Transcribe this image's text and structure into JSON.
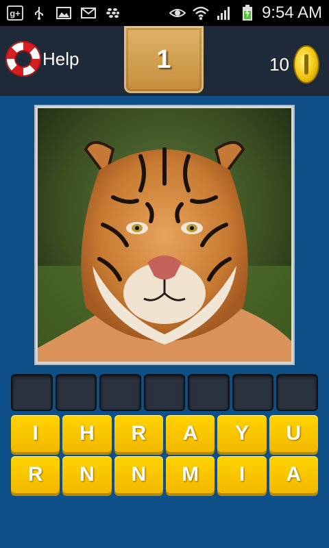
{
  "status_bar": {
    "icons": [
      "google-plus-icon",
      "usb-icon",
      "image-icon",
      "gmail-icon",
      "bbm-icon",
      "eye-icon",
      "wifi-icon",
      "signal-icon",
      "battery-icon"
    ],
    "time": "9:54 AM"
  },
  "header": {
    "help_label": "Help",
    "level": "1",
    "coins": "10"
  },
  "puzzle": {
    "image": "tiger-photo",
    "slots": [
      "",
      "",
      "",
      "",
      "",
      "",
      ""
    ],
    "letters": [
      "I",
      "H",
      "R",
      "A",
      "Y",
      "U",
      "R",
      "N",
      "N",
      "M",
      "I",
      "A"
    ]
  },
  "colors": {
    "background": "#0d4f86",
    "topbar": "#1f2a38",
    "key": "#f2b800",
    "badge": "#c48c3a"
  }
}
